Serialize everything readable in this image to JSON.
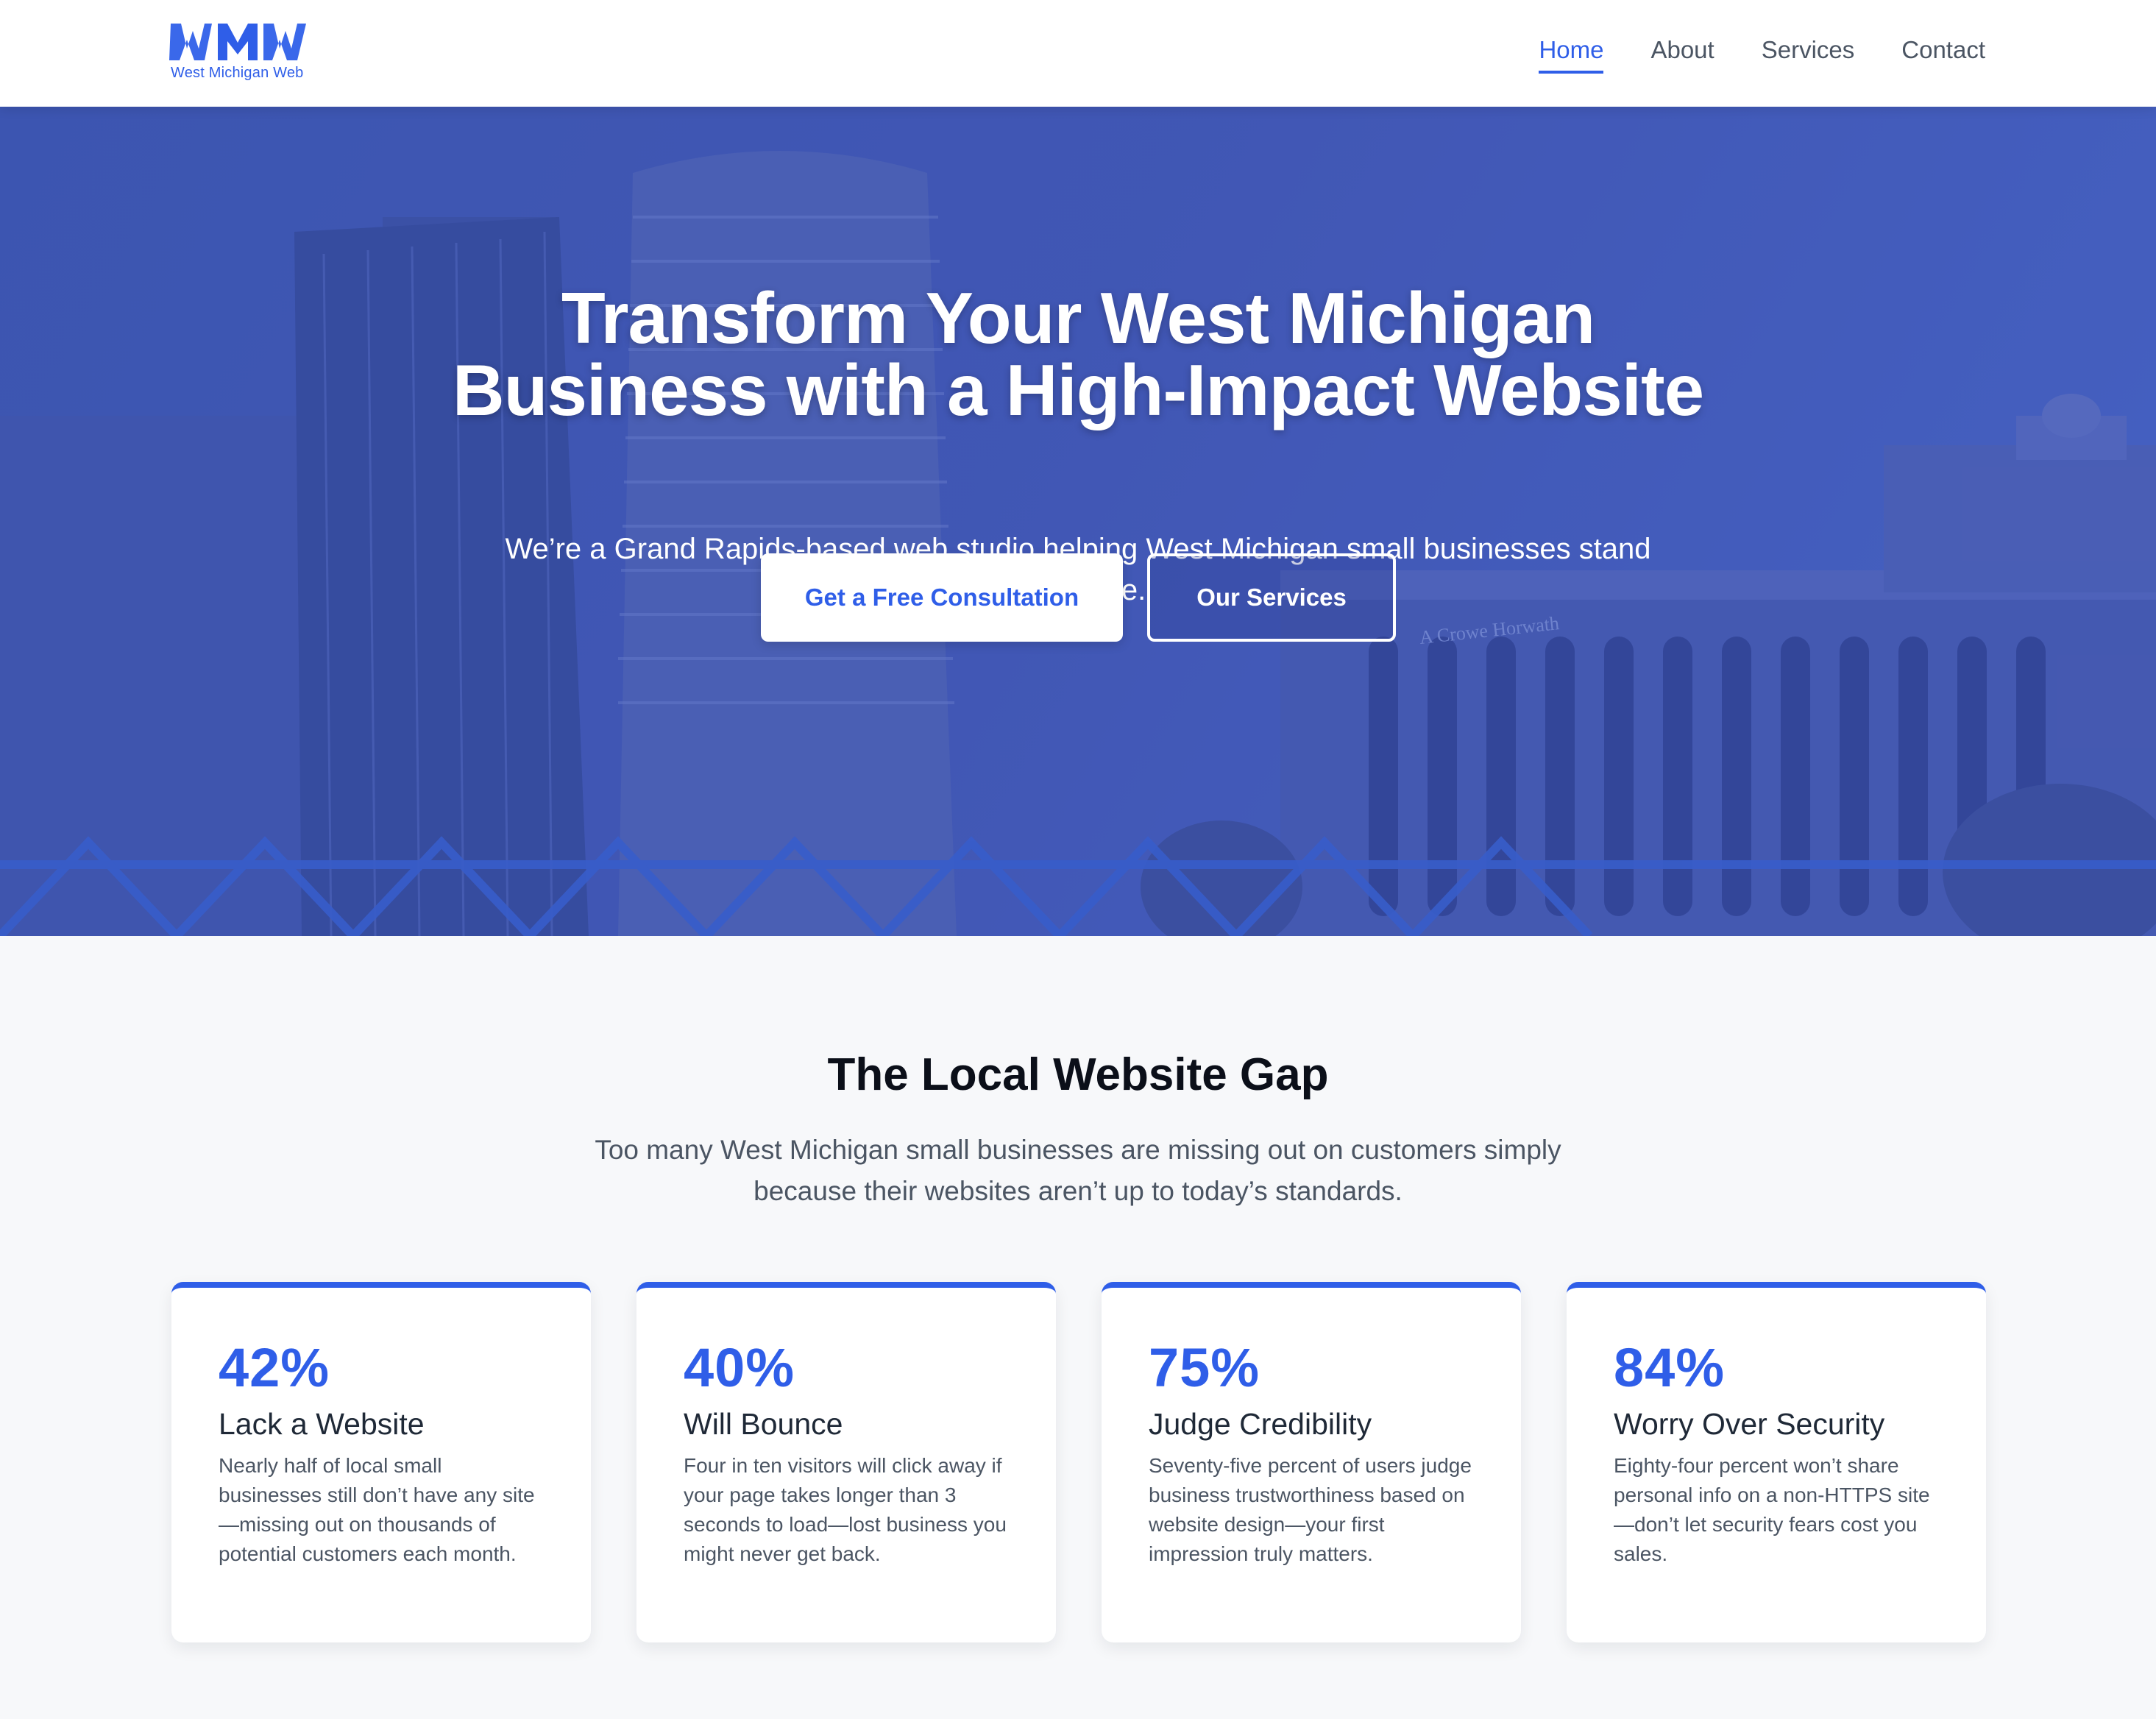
{
  "brand": {
    "logo_text": "West Michigan Web",
    "accent_color": "#2f5ee8"
  },
  "nav": {
    "items": [
      {
        "label": "Home",
        "active": true
      },
      {
        "label": "About",
        "active": false
      },
      {
        "label": "Services",
        "active": false
      },
      {
        "label": "Contact",
        "active": false
      }
    ]
  },
  "hero": {
    "title": "Transform Your West Michigan Business with a High-Impact Website",
    "subtitle": "We’re a Grand Rapids-based web studio helping West Michigan small businesses stand out online.",
    "primary_button": "Get a Free Consultation",
    "secondary_button": "Our Services",
    "background_sign_text": "A Crowe Horwath"
  },
  "gap_section": {
    "title": "The Local Website Gap",
    "subtitle": "Too many West Michigan small businesses are missing out on customers simply because their websites aren’t up to today’s standards.",
    "cards": [
      {
        "stat": "42%",
        "title": "Lack a Website",
        "description": "Nearly half of local small businesses still don’t have any site—missing out on thousands of potential customers each month."
      },
      {
        "stat": "40%",
        "title": "Will Bounce",
        "description": "Four in ten visitors will click away if your page takes longer than 3 seconds to load—lost business you might never get back."
      },
      {
        "stat": "75%",
        "title": "Judge Credibility",
        "description": "Seventy-five percent of users judge business trustworthiness based on website design—your first impression truly matters."
      },
      {
        "stat": "84%",
        "title": "Worry Over Security",
        "description": "Eighty-four percent won’t share personal info on a non-HTTPS site—don’t let security fears cost you sales."
      }
    ]
  }
}
